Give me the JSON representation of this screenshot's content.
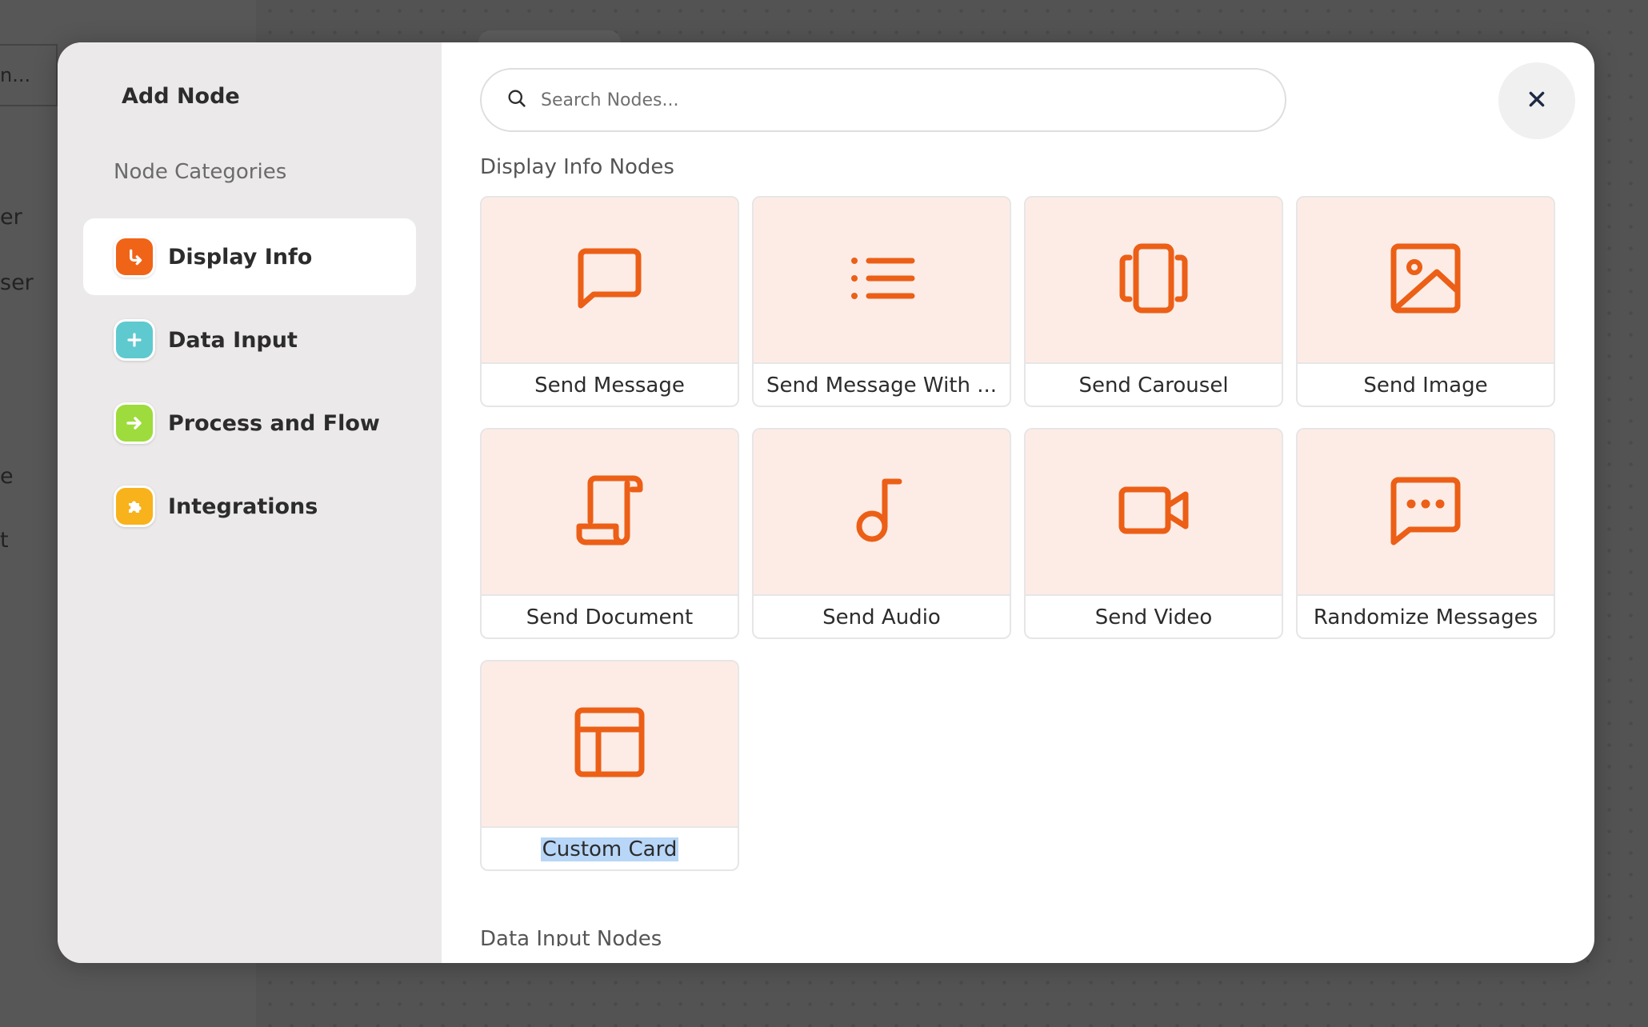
{
  "background": {
    "texts": [
      "n...",
      "er",
      "ser",
      "e",
      "t"
    ]
  },
  "sidebar": {
    "title": "Add Node",
    "subtitle": "Node Categories",
    "categories": [
      {
        "label": "Display Info",
        "color": "#f06418",
        "icon": "arrow-corner-down-right-icon",
        "active": true
      },
      {
        "label": "Data Input",
        "color": "#5fc9d0",
        "icon": "plus-icon",
        "active": false
      },
      {
        "label": "Process and Flow",
        "color": "#9ddc3c",
        "icon": "arrow-right-icon",
        "active": false
      },
      {
        "label": "Integrations",
        "color": "#f8b21c",
        "icon": "puzzle-icon",
        "active": false
      }
    ]
  },
  "search": {
    "placeholder": "Search Nodes..."
  },
  "sections": [
    {
      "title": "Display Info Nodes",
      "nodes": [
        {
          "label": "Send Message",
          "icon": "message-square-icon"
        },
        {
          "label": "Send Message With ...",
          "icon": "list-icon"
        },
        {
          "label": "Send Carousel",
          "icon": "carousel-icon"
        },
        {
          "label": "Send Image",
          "icon": "image-icon"
        },
        {
          "label": "Send Document",
          "icon": "scroll-document-icon"
        },
        {
          "label": "Send Audio",
          "icon": "music-note-icon"
        },
        {
          "label": "Send Video",
          "icon": "video-camera-icon"
        },
        {
          "label": "Randomize Messages",
          "icon": "message-dots-icon"
        },
        {
          "label": "Custom Card",
          "icon": "layout-icon"
        }
      ]
    },
    {
      "title": "Data Input Nodes"
    }
  ],
  "colors": {
    "accent": "#ec5f16",
    "card_bg": "#fdece6",
    "sidebar_bg": "#ebe9e9",
    "selection": "#b8d6f7"
  }
}
